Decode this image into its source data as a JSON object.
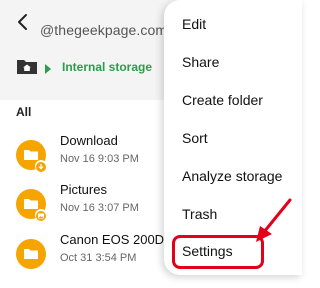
{
  "header": {
    "watermark": "@thegeekpage.com",
    "breadcrumb": "Internal storage"
  },
  "list": {
    "section_label": "All",
    "files": [
      {
        "name": "Download",
        "date": "Nov 16 9:03 PM",
        "badge": "download-icon"
      },
      {
        "name": "Pictures",
        "date": "Nov 16 3:07 PM",
        "badge": "image-icon"
      },
      {
        "name": "Canon EOS 200D",
        "date": "Oct 31 3:54 PM",
        "badge": ""
      }
    ]
  },
  "menu": {
    "items": [
      "Edit",
      "Share",
      "Create folder",
      "Sort",
      "Analyze storage",
      "Trash",
      "Settings"
    ],
    "highlighted": "Settings"
  },
  "colors": {
    "folder": "#f5a400",
    "accent_green": "#2e9c4a",
    "highlight_red": "#e2001a"
  }
}
